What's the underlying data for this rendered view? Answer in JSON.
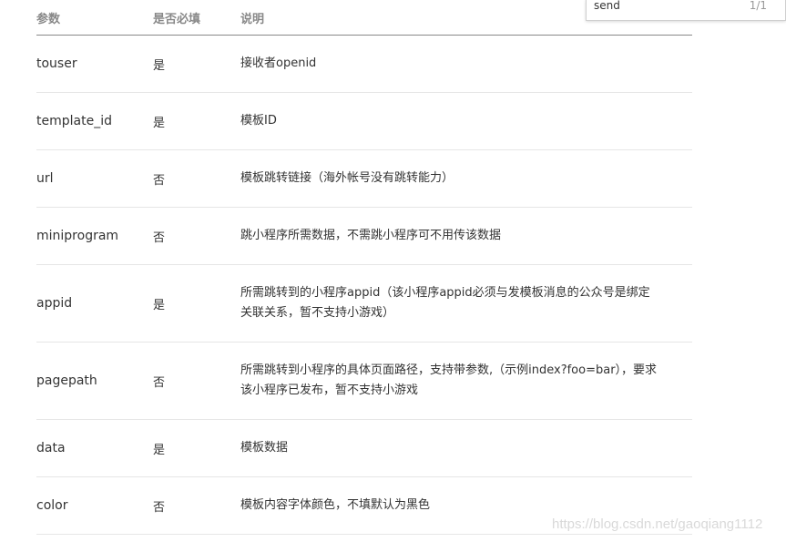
{
  "table": {
    "headers": {
      "name": "参数",
      "required": "是否必填",
      "description": "说明"
    },
    "rows": [
      {
        "name": "touser",
        "required": "是",
        "description": "接收者openid"
      },
      {
        "name": "template_id",
        "required": "是",
        "description": "模板ID"
      },
      {
        "name": "url",
        "required": "否",
        "description": "模板跳转链接（海外帐号没有跳转能力）"
      },
      {
        "name": "miniprogram",
        "required": "否",
        "description": "跳小程序所需数据，不需跳小程序可不用传该数据"
      },
      {
        "name": "appid",
        "required": "是",
        "description_lines": [
          "所需跳转到的小程序appid（该小程序appid必须与发模板消息的公众号是绑定",
          "关联关系，暂不支持小游戏）"
        ]
      },
      {
        "name": "pagepath",
        "required": "否",
        "description_lines": [
          "所需跳转到小程序的具体页面路径，支持带参数,（示例index?foo=bar），要求",
          "该小程序已发布，暂不支持小游戏"
        ]
      },
      {
        "name": "data",
        "required": "是",
        "description": "模板数据"
      },
      {
        "name": "color",
        "required": "否",
        "description": "模板内容字体颜色，不填默认为黑色"
      }
    ]
  },
  "find_bar": {
    "query": "send",
    "match_count": "1/1"
  },
  "watermark": "https://blog.csdn.net/gaoqiang1112"
}
